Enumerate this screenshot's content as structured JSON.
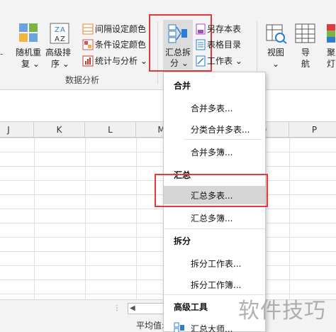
{
  "ribbon": {
    "random_reorder": [
      "随机重",
      "复"
    ],
    "advanced_sort": [
      "高级排",
      "序"
    ],
    "interval_color": "间隔设定颜色",
    "conditional_color": "条件设定颜色",
    "stats_analysis": "统计与分析",
    "data_analysis_group": "数据分析",
    "summary_split": [
      "汇总拆",
      "分"
    ],
    "save_as_table": "另存本表",
    "table_directory": "表格目录",
    "worksheet": "工作表",
    "view": "视图",
    "navigation": [
      "导",
      "航"
    ],
    "spotlight": [
      "聚",
      "灯"
    ]
  },
  "columns": [
    "J",
    "K",
    "L",
    "M",
    "O",
    "P"
  ],
  "menu": {
    "merge_header": "合并",
    "merge_items": [
      "合并多表...",
      "分类合并多表...",
      "合并多簿..."
    ],
    "summary_header": "汇总",
    "summary_items": [
      "汇总多表...",
      "汇总多簿..."
    ],
    "split_header": "拆分",
    "split_items": [
      "拆分工作表...",
      "拆分工作簿..."
    ],
    "advanced_header": "高级工具",
    "advanced_items": [
      "汇总大师..."
    ]
  },
  "status": {
    "average_label": "平均值:"
  },
  "watermark": "软件技巧",
  "colors": {
    "highlight": "#e0393e",
    "accent": "#2b7cd3"
  }
}
